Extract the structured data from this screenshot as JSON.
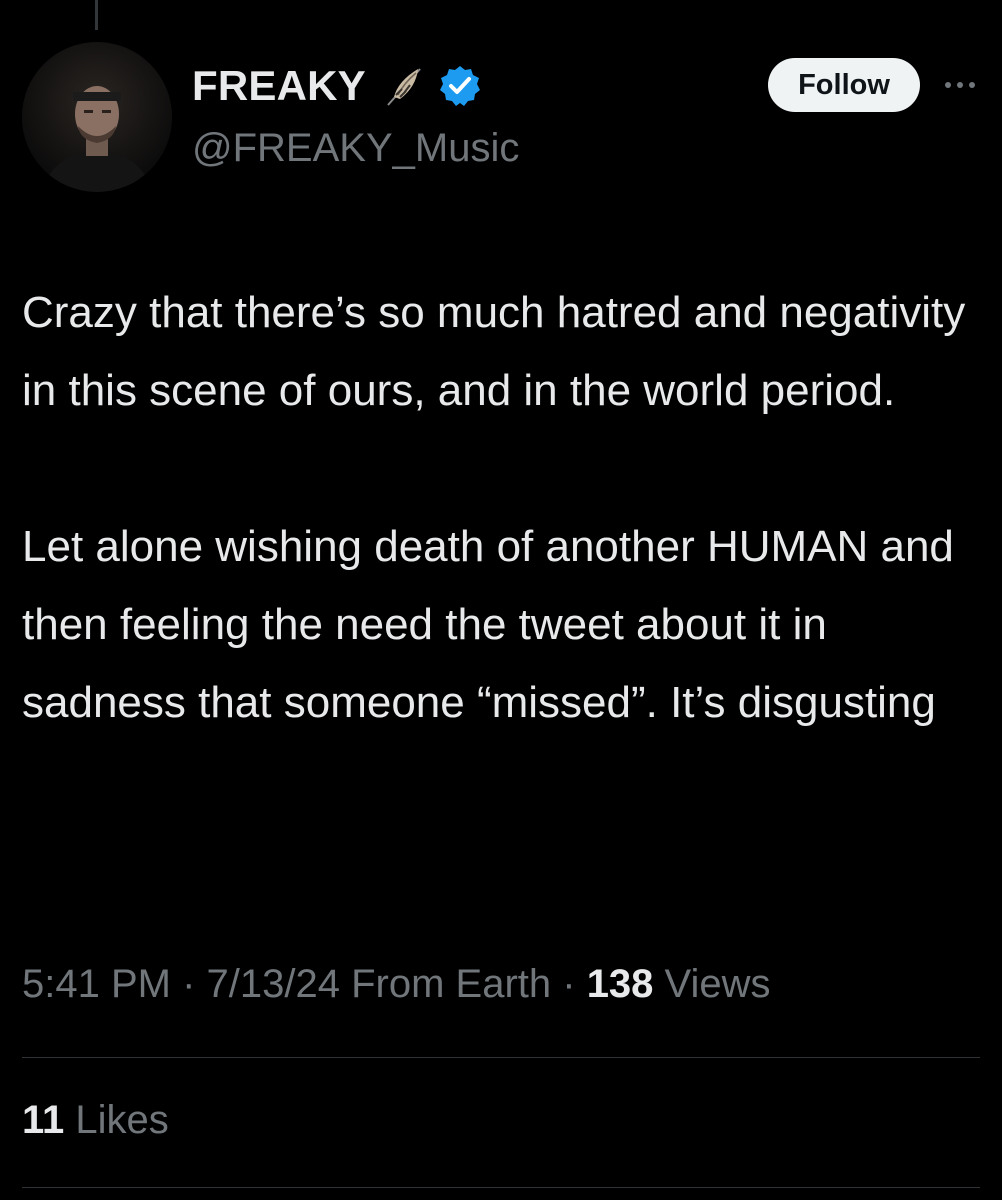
{
  "author": {
    "display_name": "FREAKY",
    "handle": "@FREAKY_Music",
    "badges": [
      "feather-icon",
      "verified-icon"
    ],
    "verified_color": "#1d9bf0"
  },
  "actions": {
    "follow_label": "Follow",
    "more_icon": "more-icon"
  },
  "tweet": {
    "paragraphs": [
      "Crazy that there’s so much hatred and negativity in this scene of ours, and in the world period.",
      "Let alone wishing death of another HUMAN and then feeling the need the tweet about it in sadness that someone “missed”. It’s disgusting"
    ]
  },
  "meta": {
    "time": "5:41 PM",
    "sep1": " · ",
    "date": "7/13/24",
    "source": " From Earth",
    "sep2": " · ",
    "views_count": "138",
    "views_label": " Views"
  },
  "engagement": {
    "likes_count": "11",
    "likes_label": " Likes"
  },
  "colors": {
    "background": "#000000",
    "primary_text": "#e7e9ea",
    "secondary_text": "#71767b",
    "divider": "#2f3336"
  }
}
